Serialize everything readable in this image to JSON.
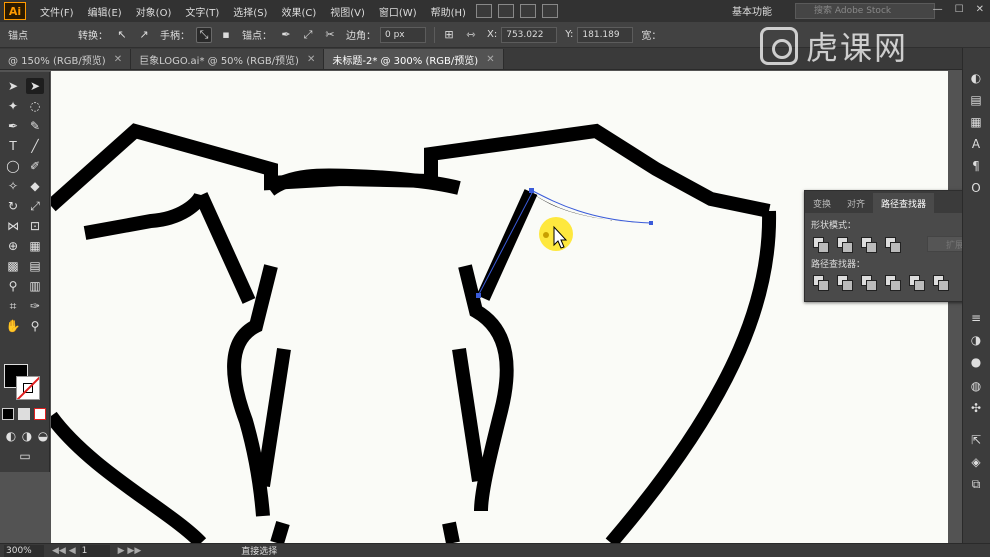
{
  "app": {
    "logo": "Ai"
  },
  "menu": [
    "文件(F)",
    "编辑(E)",
    "对象(O)",
    "文字(T)",
    "选择(S)",
    "效果(C)",
    "视图(V)",
    "窗口(W)",
    "帮助(H)"
  ],
  "workspace": "基本功能",
  "stock_search_placeholder": "搜索 Adobe Stock",
  "control": {
    "anchor_label": "锚点",
    "convert_label": "转换：",
    "handles_label": "手柄：",
    "anchor2_label": "锚点：",
    "corner_label": "边角：",
    "corner_value": "0 px",
    "x_label": "X:",
    "x_value": "753.022",
    "y_label": "Y:",
    "y_value": "181.189",
    "w_label": "宽："
  },
  "tabs": [
    {
      "label": "@ 150% (RGB/预览)",
      "active": false
    },
    {
      "label": "巨象LOGO.ai* @ 50% (RGB/预览)",
      "active": false
    },
    {
      "label": "未标题-2* @ 300% (RGB/预览)",
      "active": true
    }
  ],
  "panel": {
    "tabs": [
      "变换",
      "对齐",
      "路径查找器"
    ],
    "active_tab": 2,
    "shape_modes_label": "形状模式：",
    "pathfinders_label": "路径查找器：",
    "expand_label": "扩展"
  },
  "status": {
    "zoom": "300%",
    "page": "1",
    "tool": "直接选择"
  },
  "watermark": "虎课网",
  "colors": {
    "accent": "#ff9a00",
    "canvas_bg": "#fafbf7",
    "stroke": "#000000",
    "highlight": "#ffe200"
  }
}
